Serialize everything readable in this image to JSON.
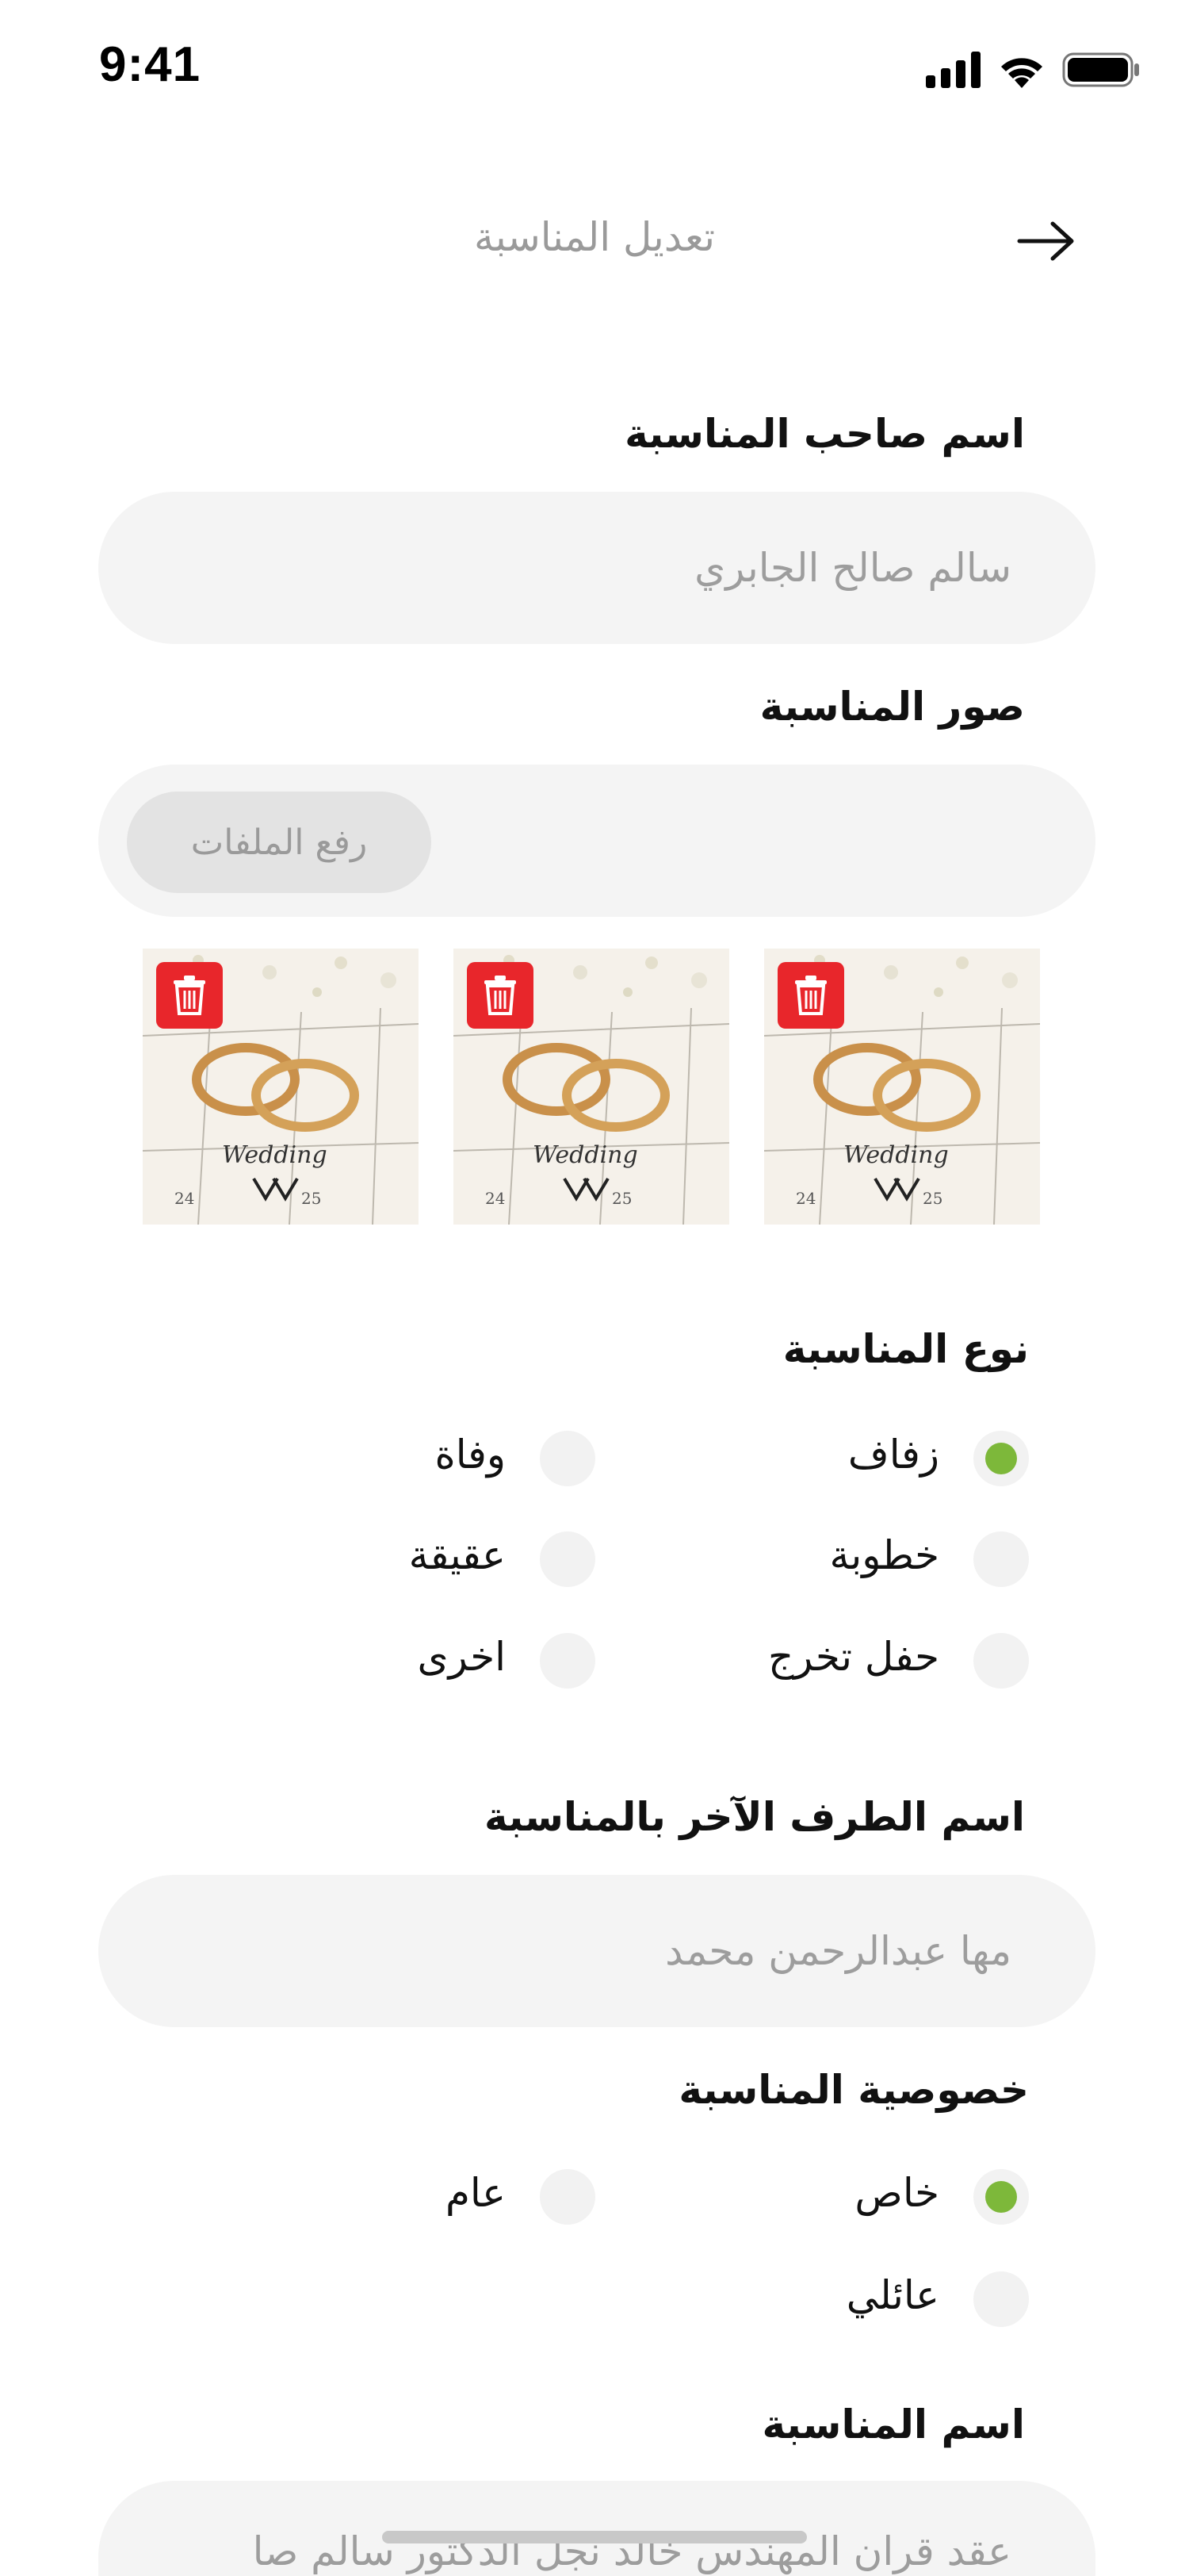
{
  "status_bar": {
    "time": "9:41"
  },
  "header": {
    "title": "تعديل المناسبة"
  },
  "owner": {
    "label": "اسم صاحب المناسبة",
    "value": "سالم صالح الجابري"
  },
  "photos": {
    "label": "صور المناسبة",
    "upload_label": "رفع الملفات",
    "count": 3
  },
  "event_type": {
    "label": "نوع المناسبة",
    "options": [
      {
        "label": "زفاف",
        "selected": true
      },
      {
        "label": "وفاة",
        "selected": false
      },
      {
        "label": "خطوبة",
        "selected": false
      },
      {
        "label": "عقيقة",
        "selected": false
      },
      {
        "label": "حفل تخرج",
        "selected": false
      },
      {
        "label": "اخرى",
        "selected": false
      }
    ]
  },
  "other_party": {
    "label": "اسم الطرف الآخر بالمناسبة",
    "value": "مها عبدالرحمن محمد"
  },
  "privacy": {
    "label": "خصوصية المناسبة",
    "options": [
      {
        "label": "خاص",
        "selected": true
      },
      {
        "label": "عام",
        "selected": false
      },
      {
        "label": "عائلي",
        "selected": false
      }
    ]
  },
  "event_name": {
    "label": "اسم المناسبة",
    "value": "عقد قران المهندس خالد نجل الدكتور سالم صا"
  },
  "colors": {
    "accent": "#7db83a",
    "danger": "#e8262b",
    "field_bg": "#f4f4f4"
  }
}
